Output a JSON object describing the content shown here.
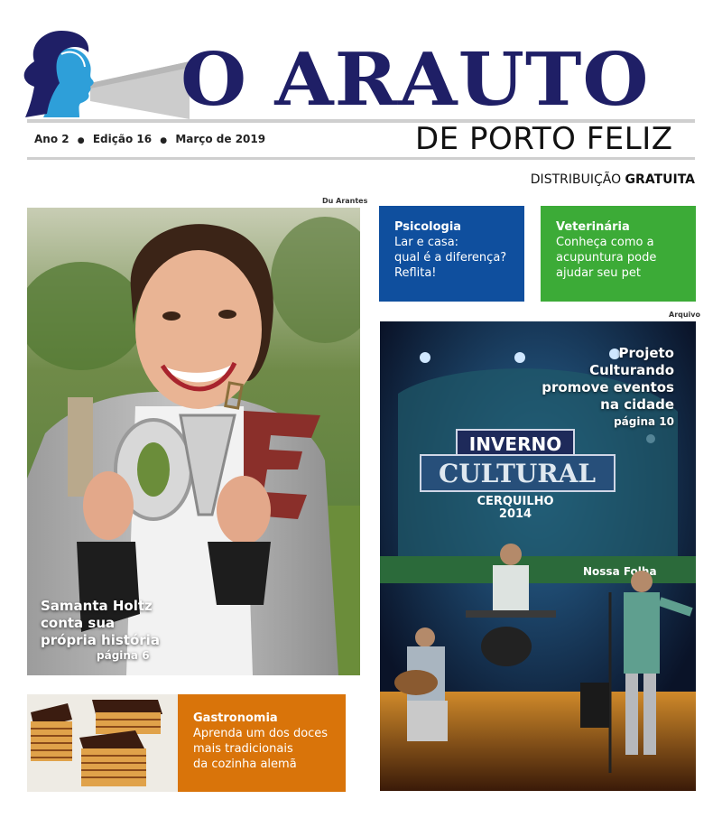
{
  "masthead": {
    "title": "O ARAUTO",
    "subtitle": "DE PORTO FELIZ",
    "edition": {
      "ano": "Ano 2",
      "edicao": "Edição 16",
      "data": "Março de 2019"
    },
    "distribution_prefix": "DISTRIBUIÇÃO",
    "distribution_bold": "GRATUITA"
  },
  "cover": {
    "credit": "Du Arantes",
    "love_text": "LOVE",
    "headline": [
      "Samanta Holtz",
      "conta sua",
      "própria história"
    ],
    "page_ref": "página 6"
  },
  "boxes": {
    "psicologia": {
      "title": "Psicologia",
      "body": [
        "Lar e casa:",
        "qual é a  diferença?",
        "Reflita!"
      ],
      "color": "#0f4f9e"
    },
    "veterinaria": {
      "title": "Veterinária",
      "body": [
        "Conheça como a",
        "acupuntura pode",
        "ajudar seu pet"
      ],
      "color": "#3cab37"
    },
    "gastronomia": {
      "title": "Gastronomia",
      "body": [
        "Aprenda um dos doces",
        "mais tradicionais",
        "da cozinha alemã"
      ],
      "color": "#d9740a"
    }
  },
  "event": {
    "credit": "Arquivo",
    "headline": [
      "Projeto",
      "Culturando",
      "promove eventos",
      "na cidade"
    ],
    "page_ref": "página 10",
    "banner_line1": "INVERNO",
    "banner_line2": "CULTURAL",
    "banner_line3": "CERQUILHO",
    "banner_line4": "2014",
    "sponsor": "Nossa Folha"
  }
}
